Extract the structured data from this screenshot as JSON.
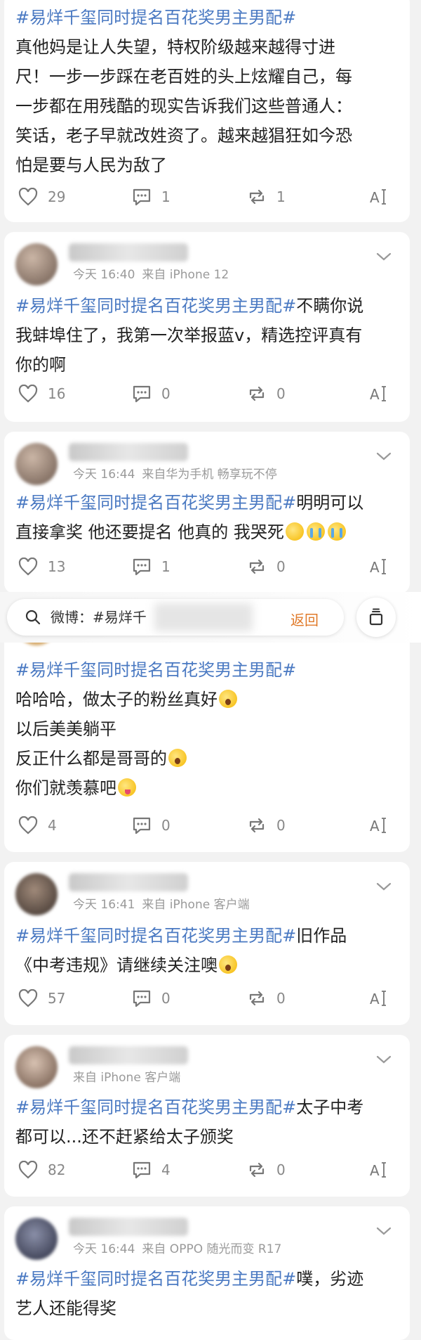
{
  "posts": [
    {
      "tag": "#易烊千玺同时提名百花奖男主男配#",
      "lines": [
        "真他妈是让人失望，特权阶级越来越得寸进",
        "尺！一步一步踩在老百姓的头上炫耀自己，每",
        "一步都在用残酷的现实告诉我们这些普通人：",
        "笑话，老子早就改姓资了。越来越猖狂如今恐",
        "怕是要与人民为敌了"
      ],
      "likes": "29",
      "comments": "1",
      "reposts": "1"
    },
    {
      "time": "今天 16:40",
      "source": "来自 iPhone 12",
      "tag": "#易烊千玺同时提名百花奖男主男配#",
      "tag_tail": "不瞒你说",
      "lines": [
        "我蚌埠住了，我第一次举报蓝v，精选控评真有",
        "你的啊"
      ],
      "likes": "16",
      "comments": "0",
      "reposts": "0"
    },
    {
      "time": "今天 16:44",
      "source": "来自华为手机 畅享玩不停",
      "tag": "#易烊千玺同时提名百花奖男主男配#",
      "tag_tail": "明明可以",
      "lines": [
        "直接拿奖 他还要提名 他真的 我哭死"
      ],
      "likes": "13",
      "comments": "1",
      "reposts": "0"
    },
    {
      "tag": "#易烊千玺同时提名百花奖男主男配#",
      "lines": [
        "哈哈哈，做太子的粉丝真好",
        "以后美美躺平",
        "反正什么都是哥哥的",
        "你们就羡慕吧"
      ],
      "likes": "4",
      "comments": "0",
      "reposts": "0"
    },
    {
      "time": "今天 16:41",
      "source": "来自 iPhone 客户端",
      "tag": "#易烊千玺同时提名百花奖男主男配#",
      "tag_tail": "旧作品",
      "lines": [
        "《中考违规》请继续关注噢"
      ],
      "likes": "57",
      "comments": "0",
      "reposts": "0"
    },
    {
      "source": "来自 iPhone 客户端",
      "tag": "#易烊千玺同时提名百花奖男主男配#",
      "tag_tail": "太子中考",
      "lines": [
        "都可以...还不赶紧给太子颁奖"
      ],
      "likes": "82",
      "comments": "4",
      "reposts": "0"
    },
    {
      "time": "今天 16:44",
      "source": "来自 OPPO 随光而变 R17",
      "tag": "#易烊千玺同时提名百花奖男主男配#",
      "tag_tail": "噗，劣迹",
      "lines": [
        "艺人还能得奖"
      ]
    }
  ],
  "search": {
    "label": "微博：#易烊千",
    "back": "返回"
  },
  "font_label": "A",
  "colors": {
    "tag": "#4a79c2",
    "back": "#e07a2a",
    "background": "#f2f2f2"
  },
  "icons": [
    "heart-icon",
    "comment-icon",
    "repost-icon",
    "font-size-icon",
    "chevron-down-icon",
    "search-icon",
    "copy-icon"
  ]
}
